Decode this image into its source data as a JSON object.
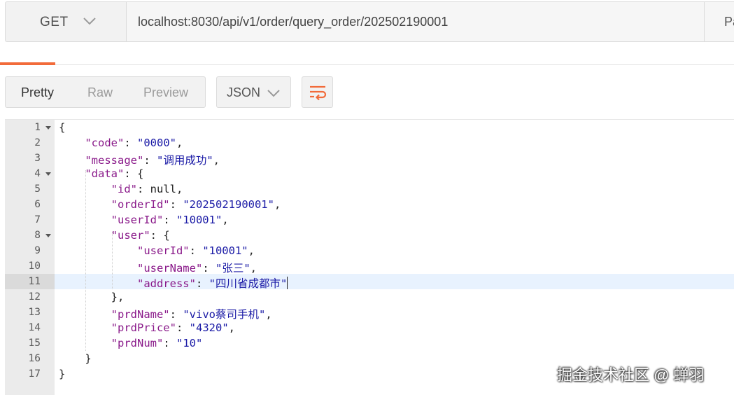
{
  "request": {
    "method": "GET",
    "url": "localhost:8030/api/v1/order/query_order/202502190001",
    "params_label": "Pa"
  },
  "response_toolbar": {
    "view_modes": [
      "Pretty",
      "Raw",
      "Preview"
    ],
    "active_view": "Pretty",
    "format": "JSON",
    "wrap_icon": "wrap-lines-icon"
  },
  "editor": {
    "active_line": 11,
    "lines": [
      [
        [
          "p",
          "{"
        ]
      ],
      [
        [
          "p",
          "    "
        ],
        [
          "k",
          "\"code\""
        ],
        [
          "p",
          ": "
        ],
        [
          "s",
          "\"0000\""
        ],
        [
          "p",
          ","
        ]
      ],
      [
        [
          "p",
          "    "
        ],
        [
          "k",
          "\"message\""
        ],
        [
          "p",
          ": "
        ],
        [
          "s",
          "\"调用成功\""
        ],
        [
          "p",
          ","
        ]
      ],
      [
        [
          "p",
          "    "
        ],
        [
          "k",
          "\"data\""
        ],
        [
          "p",
          ": {"
        ]
      ],
      [
        [
          "p",
          "        "
        ],
        [
          "k",
          "\"id\""
        ],
        [
          "p",
          ": null,"
        ]
      ],
      [
        [
          "p",
          "        "
        ],
        [
          "k",
          "\"orderId\""
        ],
        [
          "p",
          ": "
        ],
        [
          "s",
          "\"202502190001\""
        ],
        [
          "p",
          ","
        ]
      ],
      [
        [
          "p",
          "        "
        ],
        [
          "k",
          "\"userId\""
        ],
        [
          "p",
          ": "
        ],
        [
          "s",
          "\"10001\""
        ],
        [
          "p",
          ","
        ]
      ],
      [
        [
          "p",
          "        "
        ],
        [
          "k",
          "\"user\""
        ],
        [
          "p",
          ": {"
        ]
      ],
      [
        [
          "p",
          "            "
        ],
        [
          "k",
          "\"userId\""
        ],
        [
          "p",
          ": "
        ],
        [
          "s",
          "\"10001\""
        ],
        [
          "p",
          ","
        ]
      ],
      [
        [
          "p",
          "            "
        ],
        [
          "k",
          "\"userName\""
        ],
        [
          "p",
          ": "
        ],
        [
          "s",
          "\"张三\""
        ],
        [
          "p",
          ","
        ]
      ],
      [
        [
          "p",
          "            "
        ],
        [
          "k",
          "\"address\""
        ],
        [
          "p",
          ": "
        ],
        [
          "s",
          "\"四川省成都市\""
        ]
      ],
      [
        [
          "p",
          "        },"
        ]
      ],
      [
        [
          "p",
          "        "
        ],
        [
          "k",
          "\"prdName\""
        ],
        [
          "p",
          ": "
        ],
        [
          "s",
          "\"vivo蔡司手机\""
        ],
        [
          "p",
          ","
        ]
      ],
      [
        [
          "p",
          "        "
        ],
        [
          "k",
          "\"prdPrice\""
        ],
        [
          "p",
          ": "
        ],
        [
          "s",
          "\"4320\""
        ],
        [
          "p",
          ","
        ]
      ],
      [
        [
          "p",
          "        "
        ],
        [
          "k",
          "\"prdNum\""
        ],
        [
          "p",
          ": "
        ],
        [
          "s",
          "\"10\""
        ]
      ],
      [
        [
          "p",
          "    }"
        ]
      ],
      [
        [
          "p",
          "}"
        ]
      ]
    ],
    "foldable_lines": [
      1,
      4,
      8
    ]
  },
  "watermark": "掘金技术社区 @ 蝉羽",
  "colors": {
    "accent": "#f26b3a",
    "json_key": "#8a1a8a",
    "json_string": "#1a1aa6",
    "active_line_bg": "#e8f2fe"
  }
}
